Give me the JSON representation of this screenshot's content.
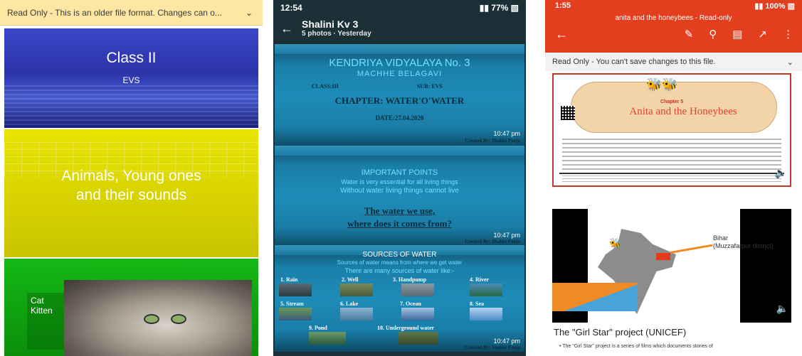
{
  "panel1": {
    "banner_text": "Read Only - This is an older file format. Changes can o...",
    "slides": {
      "s1_title": "Class II",
      "s1_subtitle": "EVS",
      "s2_title_line1": "Animals, Young ones",
      "s2_title_line2": "and their sounds",
      "s3_label_line1": "Cat",
      "s3_label_line2": "Kitten"
    }
  },
  "panel2": {
    "status_time": "12:54",
    "status_battery": "77%",
    "album_title": "Shalini Kv 3",
    "album_subtitle": "5 photos · Yesterday",
    "slide1": {
      "school": "KENDRIYA VIDYALAYA No. 3",
      "place": "MACHHE   BELAGAVI",
      "class": "CLASS:III",
      "subject": "SUB: EVS",
      "chapter": "CHAPTER: WATER'O'WATER",
      "date": "DATE:27.04.2020",
      "credit": "Created By: Shalini Pooja",
      "time": "10:47 pm"
    },
    "slide2": {
      "heading": "IMPORTANT POINTS",
      "line1": "Water is very essential for all living things",
      "line2": "Without water living things cannot live",
      "big1": "The water we use,",
      "big2": "where does it comes from?",
      "credit": "Created By: Shalini Pooja",
      "time": "10:47 pm"
    },
    "slide3": {
      "heading": "SOURCES OF WATER",
      "line1": "Sources of water means from where we get water",
      "line2": "There are many sources of water  like:-",
      "items": [
        "1. Rain",
        "2. Well",
        "3. Handpump",
        "4. River",
        "5. Stream",
        "6. Lake",
        "7. Ocean",
        "8. Sea",
        "9. Pond",
        "10. Underground water"
      ],
      "credit": "Created By: Shalini Pooja",
      "time": "10:47 pm"
    }
  },
  "panel3": {
    "status_time": "1:55",
    "status_battery": "100%",
    "doc_title": "anita and the honeybees - Read-only",
    "readonly_text": "Read Only - You can't save changes to this file.",
    "chapter_label": "Chapter 5",
    "chapter_title": "Anita and the Honeybees",
    "map_label_line1": "Bihar",
    "map_label_line2": "(Muzzafarpur district)",
    "girlstar_title": "The \"Girl Star\" project (UNICEF)",
    "girlstar_bullet": "• The \"Girl Star\" project is a series of films which documents stories of"
  },
  "colors": {
    "banner": "#fde7a3",
    "office_red": "#e33e1e",
    "slide_blue": "#1d8cb8",
    "slide_yellow": "#e9e400",
    "slide_green": "#14b814"
  }
}
